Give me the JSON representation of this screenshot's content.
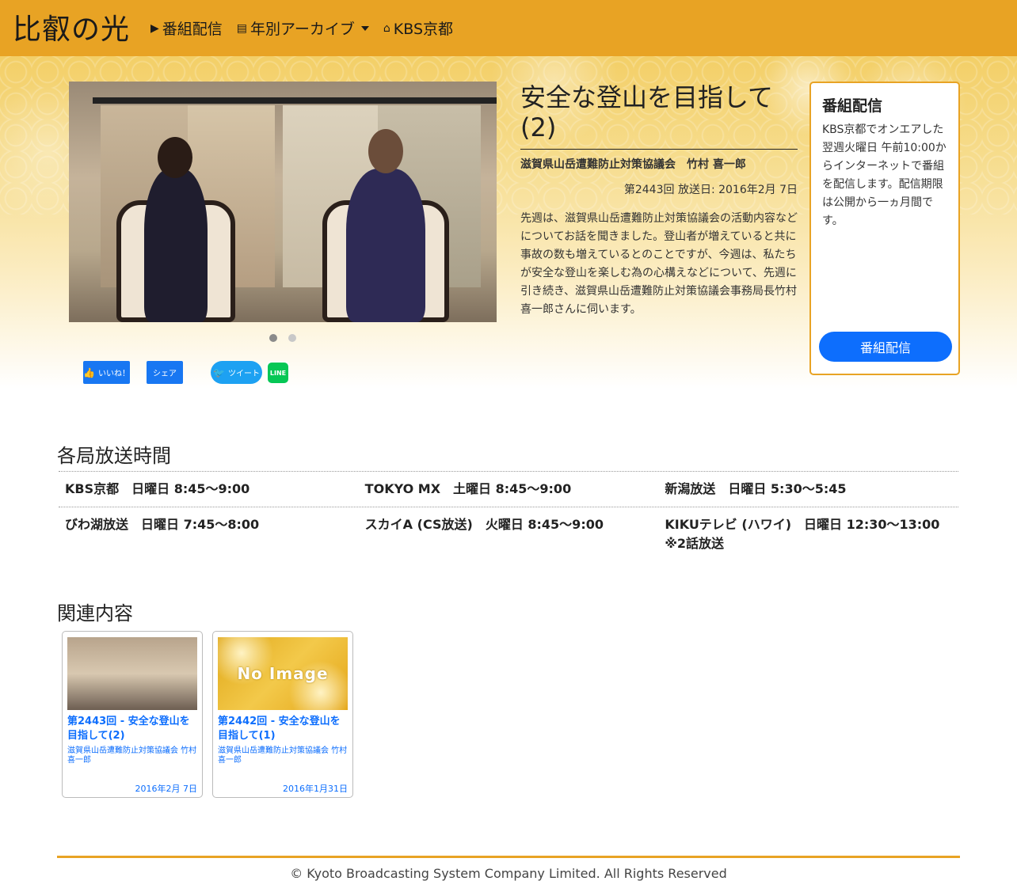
{
  "navbar": {
    "brand": "比叡の光",
    "items": [
      {
        "label": "番組配信",
        "icon": "video-icon"
      },
      {
        "label": "年別アーカイブ",
        "icon": "archive-icon"
      },
      {
        "label": "KBS京都",
        "icon": "home-icon"
      }
    ]
  },
  "episode": {
    "title": "安全な登山を目指して(2)",
    "guest": "滋賀県山岳遭難防止対策協議会　竹村 喜一郎",
    "meta": "第2443回 放送日: 2016年2月 7日",
    "description": "先週は、滋賀県山岳遭難防止対策協議会の活動内容などについてお話を聞きました。登山者が増えていると共に事故の数も増えているとのことですが、今週は、私たちが安全な登山を楽しむ為の心構えなどについて、先週に引き続き、滋賀県山岳遭難防止対策協議会事務局長竹村喜一郎さんに伺います。"
  },
  "share": {
    "fb_like": "いいね！",
    "fb_share": "シェア",
    "tweet": "ツイート",
    "line": "LINE"
  },
  "sidebox": {
    "title": "番組配信",
    "text": "KBS京都でオンエアした翌週火曜日 午前10:00からインターネットで番組を配信します。配信期限は公開から一ヵ月間です。",
    "button": "番組配信"
  },
  "schedule": {
    "title": "各局放送時間",
    "rows": [
      [
        "KBS京都　日曜日 8:45〜9:00",
        "TOKYO MX　土曜日 8:45〜9:00",
        "新潟放送　日曜日 5:30〜5:45"
      ],
      [
        "びわ湖放送　日曜日 7:45〜8:00",
        "スカイA (CS放送)　火曜日 8:45〜9:00",
        "KIKUテレビ (ハワイ)　日曜日 12:30〜13:00 ※2話放送"
      ]
    ]
  },
  "related": {
    "title": "関連内容",
    "items": [
      {
        "title": "第2443回 - 安全な登山を目指して(2)",
        "guest": "滋賀県山岳遭難防止対策協議会 竹村 喜一郎",
        "date": "2016年2月 7日",
        "thumb": "photo"
      },
      {
        "title": "第2442回 - 安全な登山を目指して(1)",
        "guest": "滋賀県山岳遭難防止対策協議会 竹村 喜一郎",
        "date": "2016年1月31日",
        "thumb": "no-image",
        "thumb_text": "No Image"
      }
    ]
  },
  "footer": {
    "copyright": "© Kyoto Broadcasting System Company Limited. All Rights Reserved"
  },
  "colors": {
    "navbar": "#e8a324",
    "primary": "#0d6efd",
    "accent_border": "#e8a324"
  }
}
